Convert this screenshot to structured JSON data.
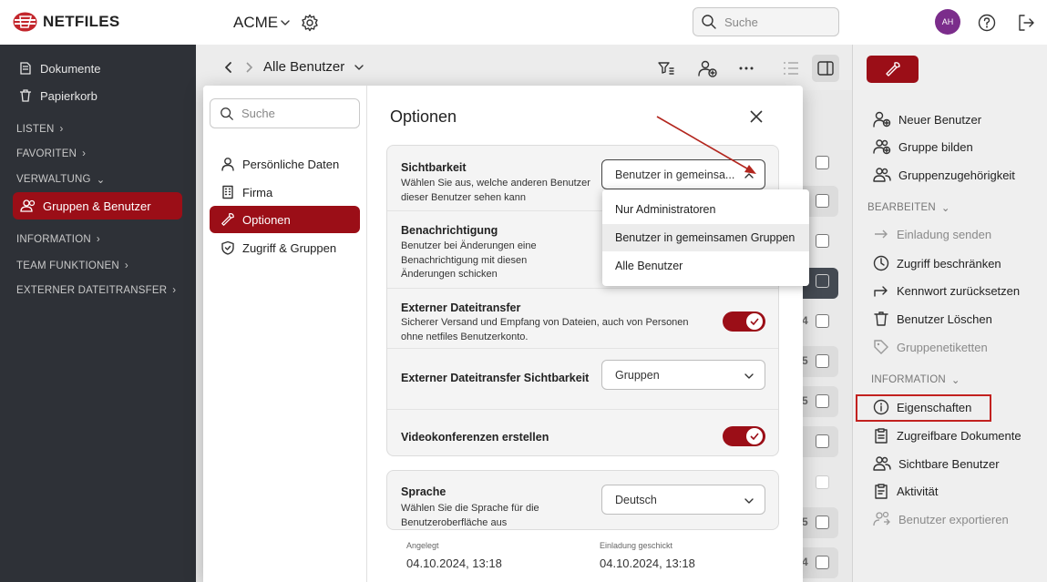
{
  "app": {
    "logo_text": "NETFILES",
    "org_name": "ACME",
    "search_placeholder": "Suche",
    "avatar_initials": "AH",
    "brand_color": "#9b0e17"
  },
  "sidebar": {
    "top_items": [
      {
        "label": "Dokumente",
        "icon": "documents-icon"
      },
      {
        "label": "Papierkorb",
        "icon": "trash-icon"
      }
    ],
    "sections": [
      "LISTEN",
      "FAVORITEN",
      "VERWALTUNG",
      "INFORMATION",
      "TEAM FUNKTIONEN",
      "EXTERNER DATEITRANSFER"
    ],
    "active_item": "Gruppen & Benutzer"
  },
  "main": {
    "breadcrumb": "Alle Benutzer",
    "row_numbers": [
      "4",
      "5",
      "5",
      "5",
      "4"
    ]
  },
  "modal": {
    "search_placeholder": "Suche",
    "nav": [
      {
        "label": "Persönliche Daten"
      },
      {
        "label": "Firma"
      },
      {
        "label": "Optionen"
      },
      {
        "label": "Zugriff & Gruppen"
      }
    ],
    "title": "Optionen",
    "rows": {
      "visibility": {
        "title": "Sichtbarkeit",
        "desc": "Wählen Sie aus, welche anderen Benutzer dieser Benutzer sehen kann",
        "value": "Benutzer in gemeinsa..."
      },
      "notification": {
        "title": "Benachrichtigung",
        "desc": "Benutzer bei Änderungen eine Benachrichtigung mit diesen Änderungen schicken"
      },
      "external": {
        "title": "Externer Dateitransfer",
        "desc": "Sicherer Versand und Empfang von Dateien, auch von Personen ohne netfiles Benutzerkonto.",
        "enabled": true
      },
      "external_visibility": {
        "title": "Externer Dateitransfer Sichtbarkeit",
        "value": "Gruppen"
      },
      "video": {
        "title": "Videokonferenzen erstellen",
        "enabled": true
      },
      "language": {
        "title": "Sprache",
        "desc": "Wählen Sie die Sprache für die Benutzeroberfläche aus",
        "value": "Deutsch"
      }
    },
    "meta": {
      "created_label": "Angelegt",
      "created_value": "04.10.2024, 13:18",
      "invited_label": "Einladung geschickt",
      "invited_value": "04.10.2024, 13:18"
    }
  },
  "dropdown": {
    "options": [
      "Nur Administratoren",
      "Benutzer in gemeinsamen Gruppen",
      "Alle Benutzer"
    ],
    "highlighted": "Benutzer in gemeinsamen Gruppen"
  },
  "right_panel": {
    "actions": [
      "Neuer Benutzer",
      "Gruppe bilden",
      "Gruppenzugehörigkeit"
    ],
    "edit_header": "BEARBEITEN",
    "edit_actions": [
      {
        "label": "Einladung senden",
        "disabled": true
      },
      {
        "label": "Zugriff beschränken",
        "disabled": false
      },
      {
        "label": "Kennwort zurücksetzen",
        "disabled": false
      },
      {
        "label": "Benutzer Löschen",
        "disabled": false
      },
      {
        "label": "Gruppenetiketten",
        "disabled": true
      }
    ],
    "info_header": "INFORMATION",
    "info_actions": [
      {
        "label": "Eigenschaften",
        "disabled": false
      },
      {
        "label": "Zugreifbare Dokumente",
        "disabled": false
      },
      {
        "label": "Sichtbare Benutzer",
        "disabled": false
      },
      {
        "label": "Aktivität",
        "disabled": false
      },
      {
        "label": "Benutzer exportieren",
        "disabled": true
      }
    ]
  }
}
